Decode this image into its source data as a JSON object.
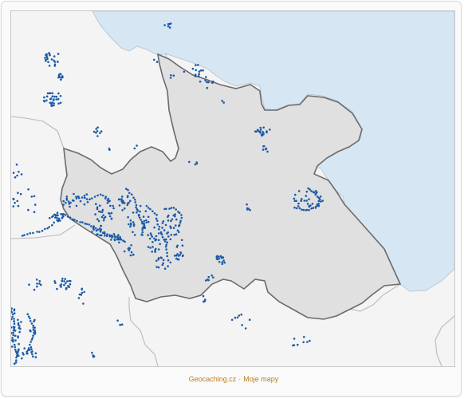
{
  "colors": {
    "water": "#d6e6f3",
    "land": "#f4f4f4",
    "region_fill": "#e0e0e0",
    "region_border": "#6b6b6b",
    "neighbor_border": "#b9b9b9",
    "cache_dot": "#1a5aa6",
    "footer_link": "#c27b1b"
  },
  "footer": {
    "site_link": "Geocaching.cz",
    "separator": "·",
    "maps_link": "Moje mapy"
  }
}
